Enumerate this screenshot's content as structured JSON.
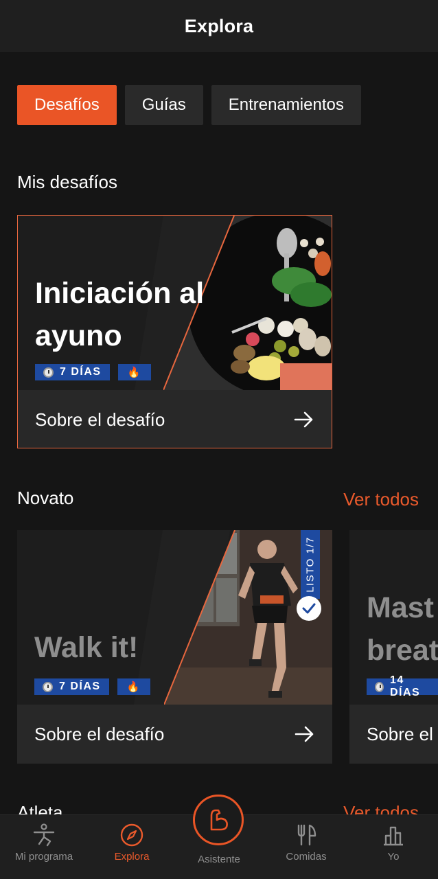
{
  "header": {
    "title": "Explora"
  },
  "tabs": [
    {
      "label": "Desafíos",
      "active": true
    },
    {
      "label": "Guías",
      "active": false
    },
    {
      "label": "Entrenamientos",
      "active": false
    }
  ],
  "my_challenges": {
    "title": "Mis desafíos",
    "card": {
      "title": "Iniciación al ayuno",
      "duration": "7 DÍAS",
      "footer": "Sobre el desafío"
    }
  },
  "novice": {
    "title": "Novato",
    "see_all": "Ver todos",
    "cards": [
      {
        "title": "Walk it!",
        "duration": "7 DÍAS",
        "footer": "Sobre el desafío",
        "status": "LISTO 1/7"
      },
      {
        "title": "Mastering breathing",
        "visible_title": "Mast breat",
        "duration": "14 DÍAS",
        "footer": "Sobre el"
      }
    ]
  },
  "athlete": {
    "title": "Atleta",
    "see_all": "Ver todos"
  },
  "bottom_nav": [
    {
      "label": "Mi programa",
      "icon": "stretch-person-icon"
    },
    {
      "label": "Explora",
      "icon": "compass-icon",
      "active": true
    },
    {
      "label": "Asistente",
      "icon": "flexed-arm-icon"
    },
    {
      "label": "Comidas",
      "icon": "fork-knife-icon"
    },
    {
      "label": "Yo",
      "icon": "bar-chart-icon"
    }
  ],
  "colors": {
    "accent": "#ea5526",
    "badge": "#1e4aa0",
    "background": "#151515",
    "card": "#282828"
  }
}
